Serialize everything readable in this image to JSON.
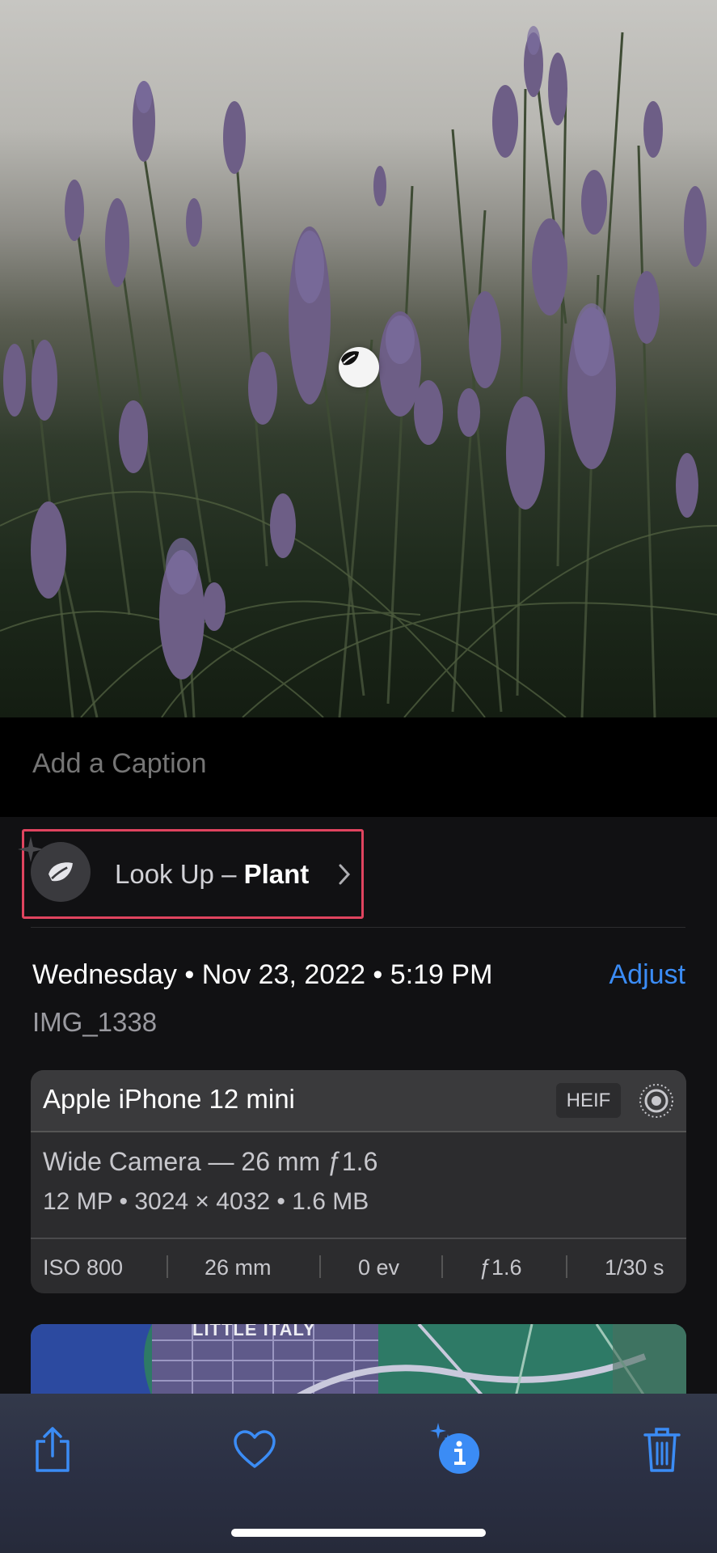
{
  "photo": {
    "subject": "lavender"
  },
  "caption": {
    "placeholder": "Add a Caption"
  },
  "lookup": {
    "prefix": "Look Up – ",
    "subject": "Plant"
  },
  "meta": {
    "date_line": "Wednesday • Nov 23, 2022 • 5:19 PM",
    "adjust_label": "Adjust",
    "filename": "IMG_1338"
  },
  "camera_card": {
    "device": "Apple iPhone 12 mini",
    "format_badge": "HEIF",
    "lens": "Wide Camera — 26 mm ƒ1.6",
    "specs": "12 MP  •  3024 × 4032  •  1.6 MB",
    "exif": [
      "ISO 800",
      "26 mm",
      "0 ev",
      "ƒ1.6",
      "1/30 s"
    ]
  },
  "map": {
    "label": "LITTLE ITALY"
  },
  "toolbar": {
    "items": [
      "share-icon",
      "heart-icon",
      "info-sparkle-icon",
      "trash-icon"
    ]
  },
  "colors": {
    "accent": "#3b8cf5",
    "highlight": "#e0445f"
  }
}
